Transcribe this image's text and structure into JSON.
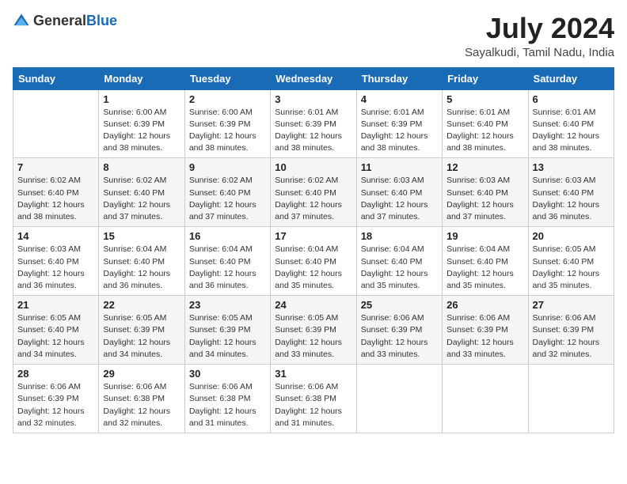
{
  "header": {
    "logo": {
      "general": "General",
      "blue": "Blue"
    },
    "title": "July 2024",
    "location": "Sayalkudi, Tamil Nadu, India"
  },
  "weekdays": [
    "Sunday",
    "Monday",
    "Tuesday",
    "Wednesday",
    "Thursday",
    "Friday",
    "Saturday"
  ],
  "weeks": [
    [
      {
        "day": "",
        "info": ""
      },
      {
        "day": "1",
        "info": "Sunrise: 6:00 AM\nSunset: 6:39 PM\nDaylight: 12 hours\nand 38 minutes."
      },
      {
        "day": "2",
        "info": "Sunrise: 6:00 AM\nSunset: 6:39 PM\nDaylight: 12 hours\nand 38 minutes."
      },
      {
        "day": "3",
        "info": "Sunrise: 6:01 AM\nSunset: 6:39 PM\nDaylight: 12 hours\nand 38 minutes."
      },
      {
        "day": "4",
        "info": "Sunrise: 6:01 AM\nSunset: 6:39 PM\nDaylight: 12 hours\nand 38 minutes."
      },
      {
        "day": "5",
        "info": "Sunrise: 6:01 AM\nSunset: 6:40 PM\nDaylight: 12 hours\nand 38 minutes."
      },
      {
        "day": "6",
        "info": "Sunrise: 6:01 AM\nSunset: 6:40 PM\nDaylight: 12 hours\nand 38 minutes."
      }
    ],
    [
      {
        "day": "7",
        "info": "Sunrise: 6:02 AM\nSunset: 6:40 PM\nDaylight: 12 hours\nand 38 minutes."
      },
      {
        "day": "8",
        "info": "Sunrise: 6:02 AM\nSunset: 6:40 PM\nDaylight: 12 hours\nand 37 minutes."
      },
      {
        "day": "9",
        "info": "Sunrise: 6:02 AM\nSunset: 6:40 PM\nDaylight: 12 hours\nand 37 minutes."
      },
      {
        "day": "10",
        "info": "Sunrise: 6:02 AM\nSunset: 6:40 PM\nDaylight: 12 hours\nand 37 minutes."
      },
      {
        "day": "11",
        "info": "Sunrise: 6:03 AM\nSunset: 6:40 PM\nDaylight: 12 hours\nand 37 minutes."
      },
      {
        "day": "12",
        "info": "Sunrise: 6:03 AM\nSunset: 6:40 PM\nDaylight: 12 hours\nand 37 minutes."
      },
      {
        "day": "13",
        "info": "Sunrise: 6:03 AM\nSunset: 6:40 PM\nDaylight: 12 hours\nand 36 minutes."
      }
    ],
    [
      {
        "day": "14",
        "info": "Sunrise: 6:03 AM\nSunset: 6:40 PM\nDaylight: 12 hours\nand 36 minutes."
      },
      {
        "day": "15",
        "info": "Sunrise: 6:04 AM\nSunset: 6:40 PM\nDaylight: 12 hours\nand 36 minutes."
      },
      {
        "day": "16",
        "info": "Sunrise: 6:04 AM\nSunset: 6:40 PM\nDaylight: 12 hours\nand 36 minutes."
      },
      {
        "day": "17",
        "info": "Sunrise: 6:04 AM\nSunset: 6:40 PM\nDaylight: 12 hours\nand 35 minutes."
      },
      {
        "day": "18",
        "info": "Sunrise: 6:04 AM\nSunset: 6:40 PM\nDaylight: 12 hours\nand 35 minutes."
      },
      {
        "day": "19",
        "info": "Sunrise: 6:04 AM\nSunset: 6:40 PM\nDaylight: 12 hours\nand 35 minutes."
      },
      {
        "day": "20",
        "info": "Sunrise: 6:05 AM\nSunset: 6:40 PM\nDaylight: 12 hours\nand 35 minutes."
      }
    ],
    [
      {
        "day": "21",
        "info": "Sunrise: 6:05 AM\nSunset: 6:40 PM\nDaylight: 12 hours\nand 34 minutes."
      },
      {
        "day": "22",
        "info": "Sunrise: 6:05 AM\nSunset: 6:39 PM\nDaylight: 12 hours\nand 34 minutes."
      },
      {
        "day": "23",
        "info": "Sunrise: 6:05 AM\nSunset: 6:39 PM\nDaylight: 12 hours\nand 34 minutes."
      },
      {
        "day": "24",
        "info": "Sunrise: 6:05 AM\nSunset: 6:39 PM\nDaylight: 12 hours\nand 33 minutes."
      },
      {
        "day": "25",
        "info": "Sunrise: 6:06 AM\nSunset: 6:39 PM\nDaylight: 12 hours\nand 33 minutes."
      },
      {
        "day": "26",
        "info": "Sunrise: 6:06 AM\nSunset: 6:39 PM\nDaylight: 12 hours\nand 33 minutes."
      },
      {
        "day": "27",
        "info": "Sunrise: 6:06 AM\nSunset: 6:39 PM\nDaylight: 12 hours\nand 32 minutes."
      }
    ],
    [
      {
        "day": "28",
        "info": "Sunrise: 6:06 AM\nSunset: 6:39 PM\nDaylight: 12 hours\nand 32 minutes."
      },
      {
        "day": "29",
        "info": "Sunrise: 6:06 AM\nSunset: 6:38 PM\nDaylight: 12 hours\nand 32 minutes."
      },
      {
        "day": "30",
        "info": "Sunrise: 6:06 AM\nSunset: 6:38 PM\nDaylight: 12 hours\nand 31 minutes."
      },
      {
        "day": "31",
        "info": "Sunrise: 6:06 AM\nSunset: 6:38 PM\nDaylight: 12 hours\nand 31 minutes."
      },
      {
        "day": "",
        "info": ""
      },
      {
        "day": "",
        "info": ""
      },
      {
        "day": "",
        "info": ""
      }
    ]
  ]
}
